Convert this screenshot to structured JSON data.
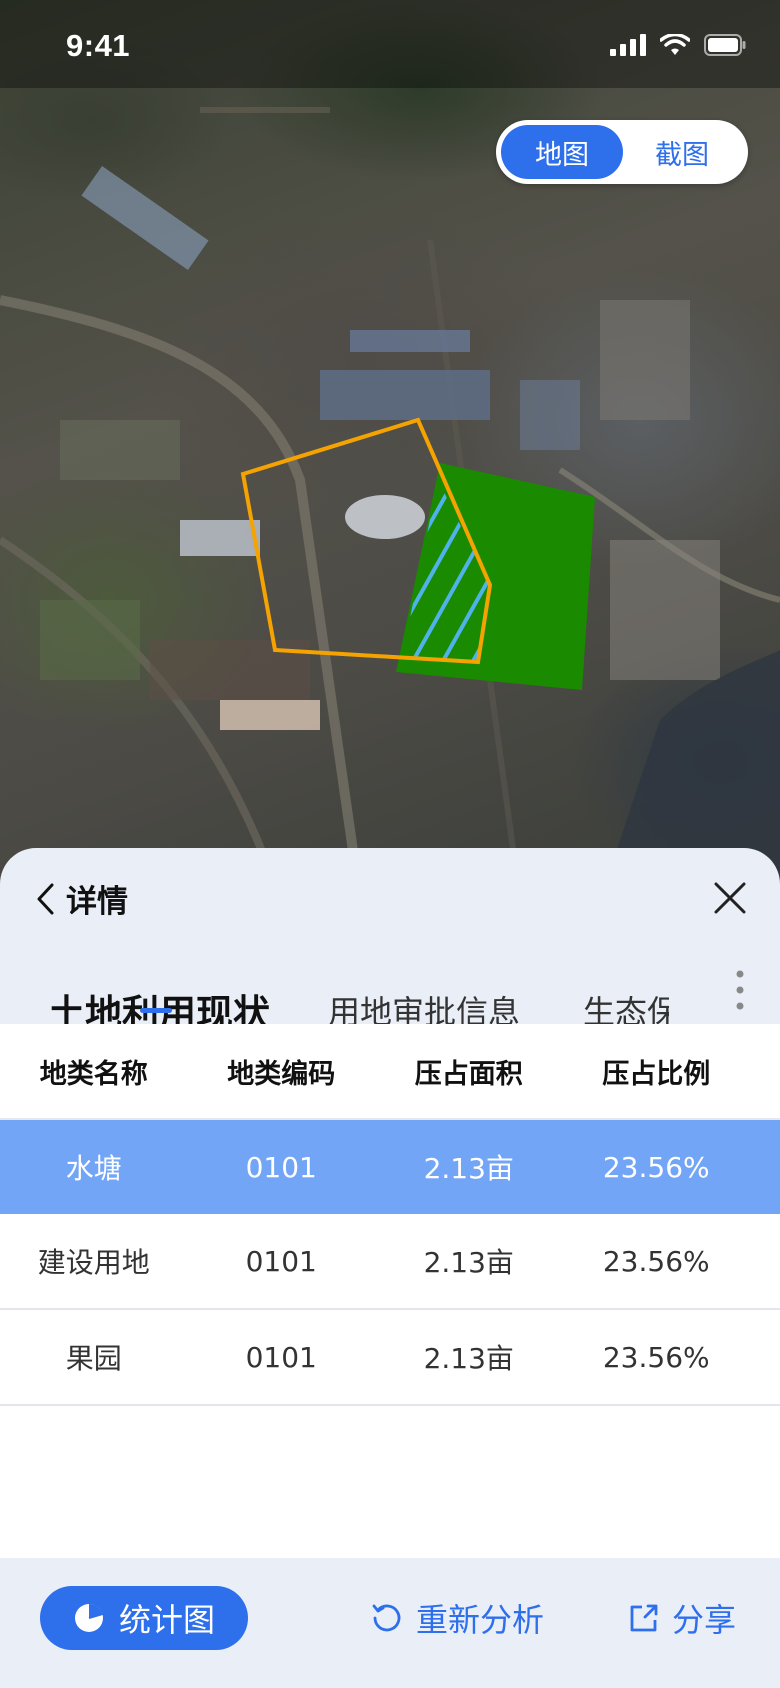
{
  "status_bar": {
    "time": "9:41",
    "icons": [
      "signal-icon",
      "wifi-icon",
      "battery-icon"
    ]
  },
  "map": {
    "toggle": {
      "map_label": "地图",
      "screenshot_label": "截图",
      "selected": "地图"
    },
    "overlay_colors": {
      "outline": "#f5a300",
      "fill": "#1a8a00",
      "hatch": "#4fb2ea"
    }
  },
  "sheet": {
    "title": "详情",
    "tabs": [
      {
        "label": "土地利用现状",
        "active": true
      },
      {
        "label": "用地审批信息",
        "active": false
      },
      {
        "label": "生态保",
        "active": false
      }
    ],
    "table": {
      "columns": [
        "地类名称",
        "地类编码",
        "压占面积",
        "压占比例"
      ],
      "rows": [
        [
          "水塘",
          "0101",
          "2.13亩",
          "23.56%"
        ],
        [
          "建设用地",
          "0101",
          "2.13亩",
          "23.56%"
        ],
        [
          "果园",
          "0101",
          "2.13亩",
          "23.56%"
        ]
      ],
      "selected_row": 0
    }
  },
  "bottom_bar": {
    "stats_label": "统计图",
    "reanalyze_label": "重新分析",
    "share_label": "分享"
  },
  "colors": {
    "accent": "#2e6fec",
    "selected_row": "#73a5f7",
    "sheet_bg": "#e9eef7"
  }
}
